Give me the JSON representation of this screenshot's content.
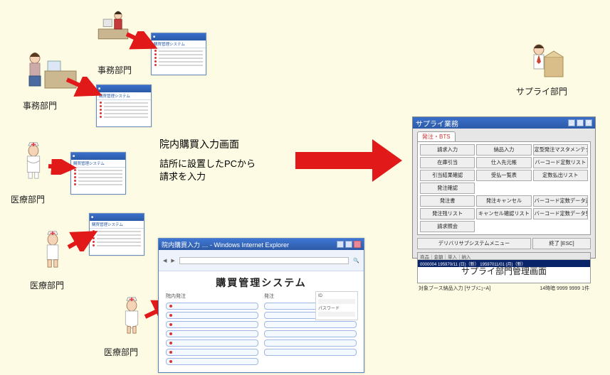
{
  "labels": {
    "jimu1": "事務部門",
    "jimu2": "事務部門",
    "iryo1": "医療部門",
    "iryo2": "医療部門",
    "iryo3": "医療部門",
    "supply_dept": "サプライ部門",
    "supply_screen": "サプライ部門管理画面"
  },
  "center": {
    "title": "院内購買入力画面",
    "desc1": "詰所に設置したPCから",
    "desc2": "請求を入力"
  },
  "mini_window": {
    "subtitle": "購買管理システム"
  },
  "big_window": {
    "titlebar": "院内購買入力 … - Windows Internet Explorer",
    "header": "購買管理システム",
    "cat_left": "院内発注",
    "cat_right": "発注",
    "login_label1": "ID",
    "login_label2": "パスワード"
  },
  "supply_window": {
    "titlebar": "サプライ業務",
    "tab": "発注・BTS",
    "buttons_grid": [
      "請求入力",
      "納品入力",
      "定型発注マスタメンテナンス",
      "在庫引当",
      "仕入先元帳",
      "バーコード定数リスト",
      "引当結果確認",
      "受払一覧表",
      "定数払出リスト",
      "発注確認",
      "",
      "",
      "発注書",
      "発注キャンセル",
      "バーコード定数データ送信",
      "発注残リスト",
      "キャンセル確認リスト",
      "バーコード定数データ受信",
      "請求照会",
      "",
      ""
    ],
    "bottom_bar": [
      "デリバリサブシステムメニュー",
      "終了 [ESC]"
    ],
    "table_header": "商品｜金額｜単入｜納入",
    "table_row": "0000004 195970/11 (日)（新）    19597011/01 (月)（新）",
    "status_left": "対象ブース納品入力 [サブﾒﾆｭｰA]",
    "status_right": "14時暗    9999  9999    1件"
  }
}
